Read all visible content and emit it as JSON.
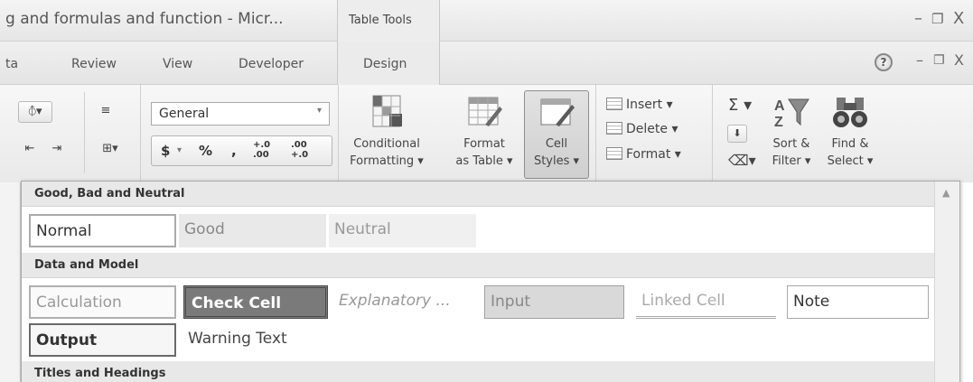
{
  "window": {
    "title": "g and formulas and function - Micr...",
    "context_tab_group": "Table Tools",
    "controls": {
      "minimize": "–",
      "restore": "❐",
      "close": "X"
    }
  },
  "tabs": [
    {
      "label": "ta"
    },
    {
      "label": "Review"
    },
    {
      "label": "View"
    },
    {
      "label": "Developer"
    },
    {
      "label": "Design"
    }
  ],
  "doc_controls": {
    "help": "?",
    "minimize": "–",
    "restore": "❐",
    "close": "X"
  },
  "ribbon": {
    "number_format": {
      "value": "General"
    },
    "number_row": {
      "currency": "$",
      "percent": "%",
      "comma": ",",
      "inc_dec": "+.0 .00",
      "dec_dec": ".00 +.0"
    },
    "styles": {
      "conditional_formatting": {
        "line1": "Conditional",
        "line2": "Formatting ▾"
      },
      "format_as_table": {
        "line1": "Format",
        "line2": "as Table ▾"
      },
      "cell_styles": {
        "line1": "Cell",
        "line2": "Styles ▾"
      }
    },
    "cells": {
      "insert": "Insert ▾",
      "delete": "Delete ▾",
      "format": "Format ▾"
    },
    "editing": {
      "sum": "Σ ▾",
      "sort_filter": {
        "line1": "Sort &",
        "line2": "Filter ▾"
      },
      "find_select": {
        "line1": "Find &",
        "line2": "Select ▾"
      }
    }
  },
  "gallery": {
    "sections": [
      {
        "header": "Good, Bad and Neutral",
        "styles": [
          "Normal",
          "Good",
          "Neutral"
        ]
      },
      {
        "header": "Data and Model",
        "styles": [
          "Calculation",
          "Check Cell",
          "Explanatory ...",
          "Input",
          "Linked Cell",
          "Note",
          "Output",
          "Warning Text"
        ]
      },
      {
        "header": "Titles and Headings",
        "styles": []
      }
    ]
  },
  "colors": {
    "check_cell_fill": "#7a7a7a",
    "ribbon_bg": "#efefef",
    "section_header_bg": "#e8e8e8"
  }
}
